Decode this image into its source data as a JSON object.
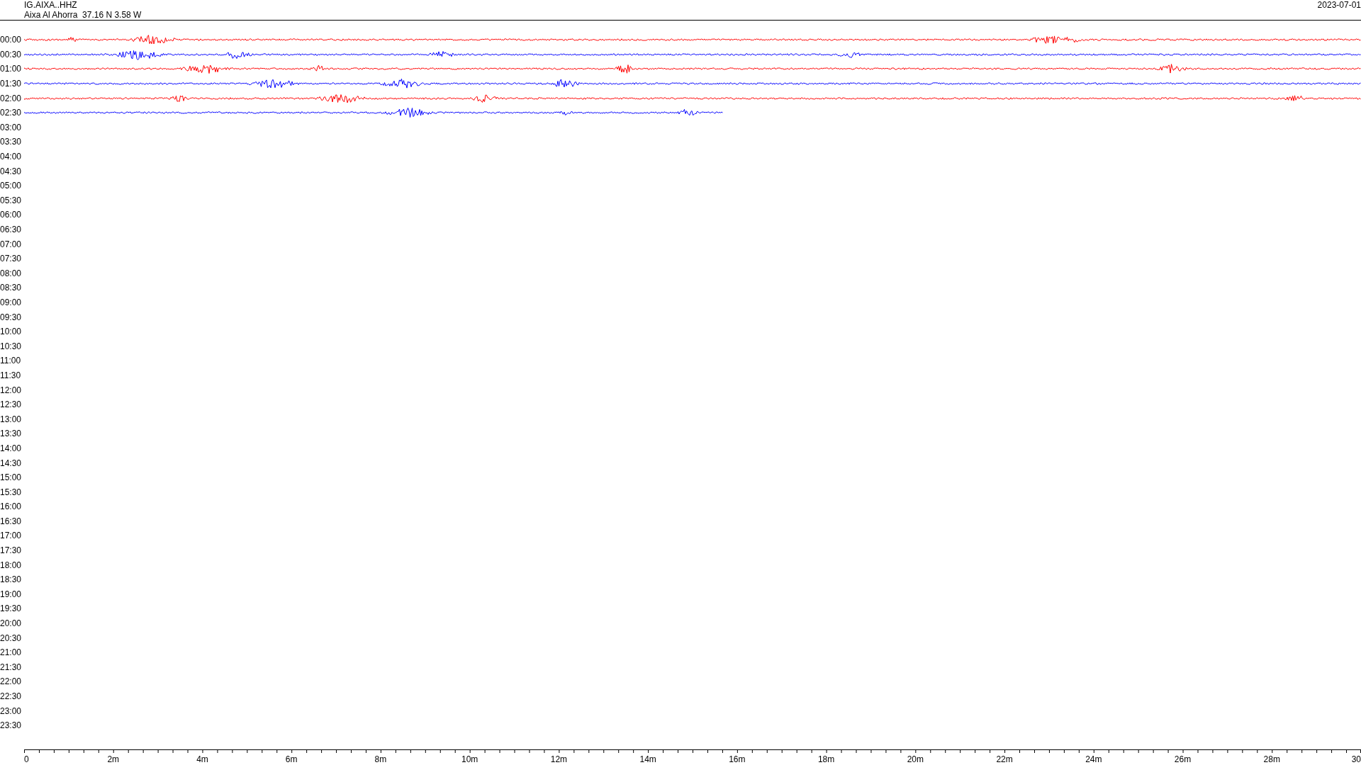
{
  "header": {
    "station_code": "IG.AIXA..HHZ",
    "station_info": "Aixa Al Ahorra  37.16 N 3.58 W",
    "date": "2023-07-01"
  },
  "rows": [
    {
      "time": "00:00",
      "trace": {
        "color": "#ff0000",
        "level": 1
      }
    },
    {
      "time": "00:30",
      "trace": {
        "color": "#0000ff",
        "level": 1
      }
    },
    {
      "time": "01:00",
      "trace": {
        "color": "#ff0000",
        "level": 1
      }
    },
    {
      "time": "01:30",
      "trace": {
        "color": "#0000ff",
        "level": 1
      }
    },
    {
      "time": "02:00",
      "trace": {
        "color": "#ff0000",
        "level": 1
      }
    },
    {
      "time": "02:30",
      "trace": {
        "color": "#0000ff",
        "level": 0.523
      }
    },
    {
      "time": "03:00"
    },
    {
      "time": "03:30"
    },
    {
      "time": "04:00"
    },
    {
      "time": "04:30"
    },
    {
      "time": "05:00"
    },
    {
      "time": "05:30"
    },
    {
      "time": "06:00"
    },
    {
      "time": "06:30"
    },
    {
      "time": "07:00"
    },
    {
      "time": "07:30"
    },
    {
      "time": "08:00"
    },
    {
      "time": "08:30"
    },
    {
      "time": "09:00"
    },
    {
      "time": "09:30"
    },
    {
      "time": "10:00"
    },
    {
      "time": "10:30"
    },
    {
      "time": "11:00"
    },
    {
      "time": "11:30"
    },
    {
      "time": "12:00"
    },
    {
      "time": "12:30"
    },
    {
      "time": "13:00"
    },
    {
      "time": "13:30"
    },
    {
      "time": "14:00"
    },
    {
      "time": "14:30"
    },
    {
      "time": "15:00"
    },
    {
      "time": "15:30"
    },
    {
      "time": "16:00"
    },
    {
      "time": "16:30"
    },
    {
      "time": "17:00"
    },
    {
      "time": "17:30"
    },
    {
      "time": "18:00"
    },
    {
      "time": "18:30"
    },
    {
      "time": "19:00"
    },
    {
      "time": "19:30"
    },
    {
      "time": "20:00"
    },
    {
      "time": "20:30"
    },
    {
      "time": "21:00"
    },
    {
      "time": "21:30"
    },
    {
      "time": "22:00"
    },
    {
      "time": "22:30"
    },
    {
      "time": "23:00"
    },
    {
      "time": "23:30"
    }
  ],
  "x_axis": {
    "labels": [
      "0",
      "2m",
      "4m",
      "6m",
      "8m",
      "10m",
      "12m",
      "14m",
      "16m",
      "18m",
      "20m",
      "22m",
      "24m",
      "26m",
      "28m",
      "30"
    ]
  }
}
